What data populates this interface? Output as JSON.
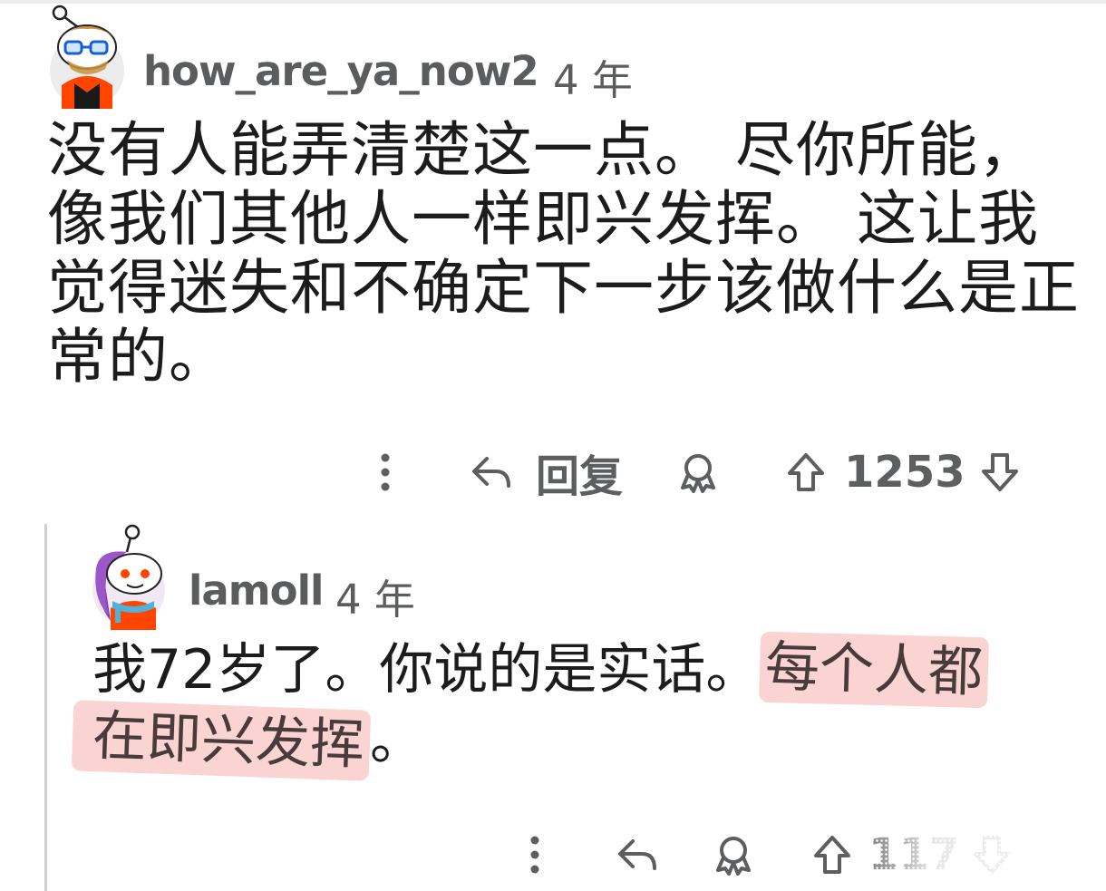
{
  "comment1": {
    "username": "how_are_ya_now2",
    "age": "4 年",
    "body_lines": [
      "没有人能弄清楚这一点。 尽你所能，",
      "像我们其他人一样即兴发挥。 这让我",
      "觉得迷失和不确定下一步该做什么是正",
      "常的。"
    ],
    "actions": {
      "more_icon": "more-vertical-icon",
      "reply_label": "回复",
      "award_icon": "award-icon",
      "score": "1253"
    }
  },
  "comment2": {
    "username": "lamoll",
    "age": "4 年",
    "line1_plain": "我72岁了。你说的是实话。",
    "line1_highlight": "每个人都",
    "line2_highlight": "在即兴发挥",
    "line2_tail": "。",
    "actions": {
      "more_icon": "more-vertical-icon",
      "award_icon": "award-icon",
      "score": "117"
    }
  },
  "colors": {
    "meta_text": "#5a5c5e",
    "highlight": "#f49696",
    "thread_line": "#d0d0d0"
  }
}
